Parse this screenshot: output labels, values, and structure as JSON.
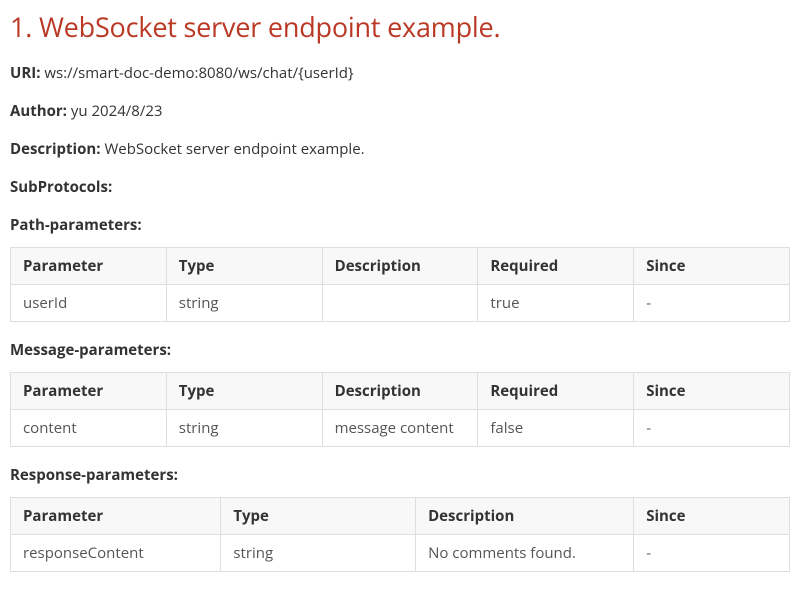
{
  "heading": "1. WebSocket server endpoint example.",
  "meta": {
    "uri_label": "URI:",
    "uri_value": "ws://smart-doc-demo:8080/ws/chat/{userId}",
    "author_label": "Author:",
    "author_value": "yu 2024/8/23",
    "description_label": "Description:",
    "description_value": "WebSocket server endpoint example.",
    "subprotocols_label": "SubProtocols:"
  },
  "path_params": {
    "label": "Path-parameters:",
    "headers": [
      "Parameter",
      "Type",
      "Description",
      "Required",
      "Since"
    ],
    "rows": [
      {
        "c0": "userId",
        "c1": "string",
        "c2": "",
        "c3": "true",
        "c4": "-"
      }
    ]
  },
  "message_params": {
    "label": "Message-parameters:",
    "headers": [
      "Parameter",
      "Type",
      "Description",
      "Required",
      "Since"
    ],
    "rows": [
      {
        "c0": "content",
        "c1": "string",
        "c2": "message content",
        "c3": "false",
        "c4": "-"
      }
    ]
  },
  "response_params": {
    "label": "Response-parameters:",
    "headers": [
      "Parameter",
      "Type",
      "Description",
      "Since"
    ],
    "rows": [
      {
        "c0": "responseContent",
        "c1": "string",
        "c2": "No comments found.",
        "c3": "-"
      }
    ]
  }
}
